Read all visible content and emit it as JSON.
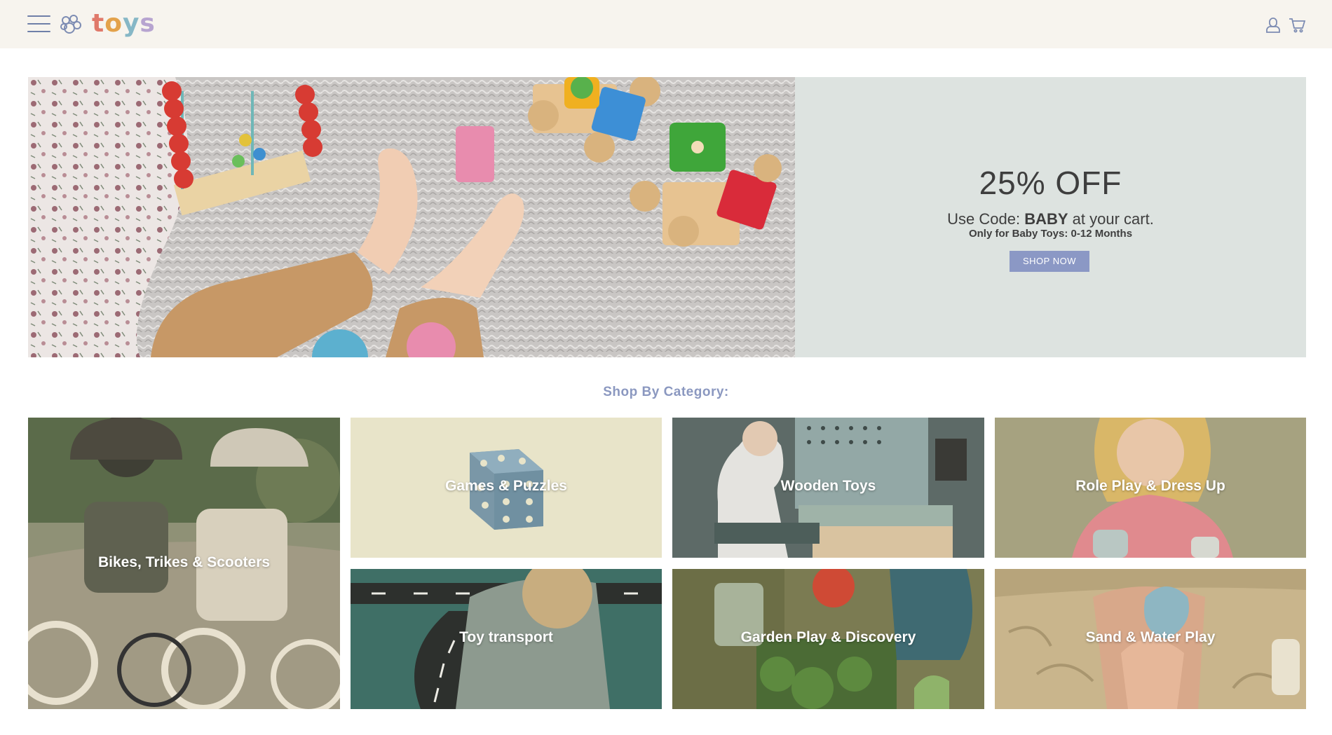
{
  "header": {
    "logo_letters": [
      "t",
      "o",
      "y",
      "s"
    ],
    "logo_colors": [
      "#e0796a",
      "#e3a24b",
      "#86b7c6",
      "#b7a4d0"
    ],
    "menu_icon": "hamburger-icon",
    "brand_icon": "paw-icon",
    "account_icon": "user-icon",
    "cart_icon": "cart-icon"
  },
  "hero": {
    "title": "25% OFF",
    "code_prefix": "Use Code: ",
    "code": "BABY",
    "code_suffix": " at your cart.",
    "note": "Only for Baby Toys: 0-12 Months",
    "cta": "SHOP NOW",
    "cta_color": "#8b98c5",
    "panel_color": "#dde3e0"
  },
  "categories": {
    "heading": "Shop By Category:",
    "items": [
      {
        "label": "Bikes, Trikes & Scooters"
      },
      {
        "label": "Games & Puzzles"
      },
      {
        "label": "Wooden Toys"
      },
      {
        "label": "Role Play & Dress Up"
      },
      {
        "label": "Toy transport"
      },
      {
        "label": "Garden Play & Discovery"
      },
      {
        "label": "Sand & Water Play"
      }
    ]
  }
}
